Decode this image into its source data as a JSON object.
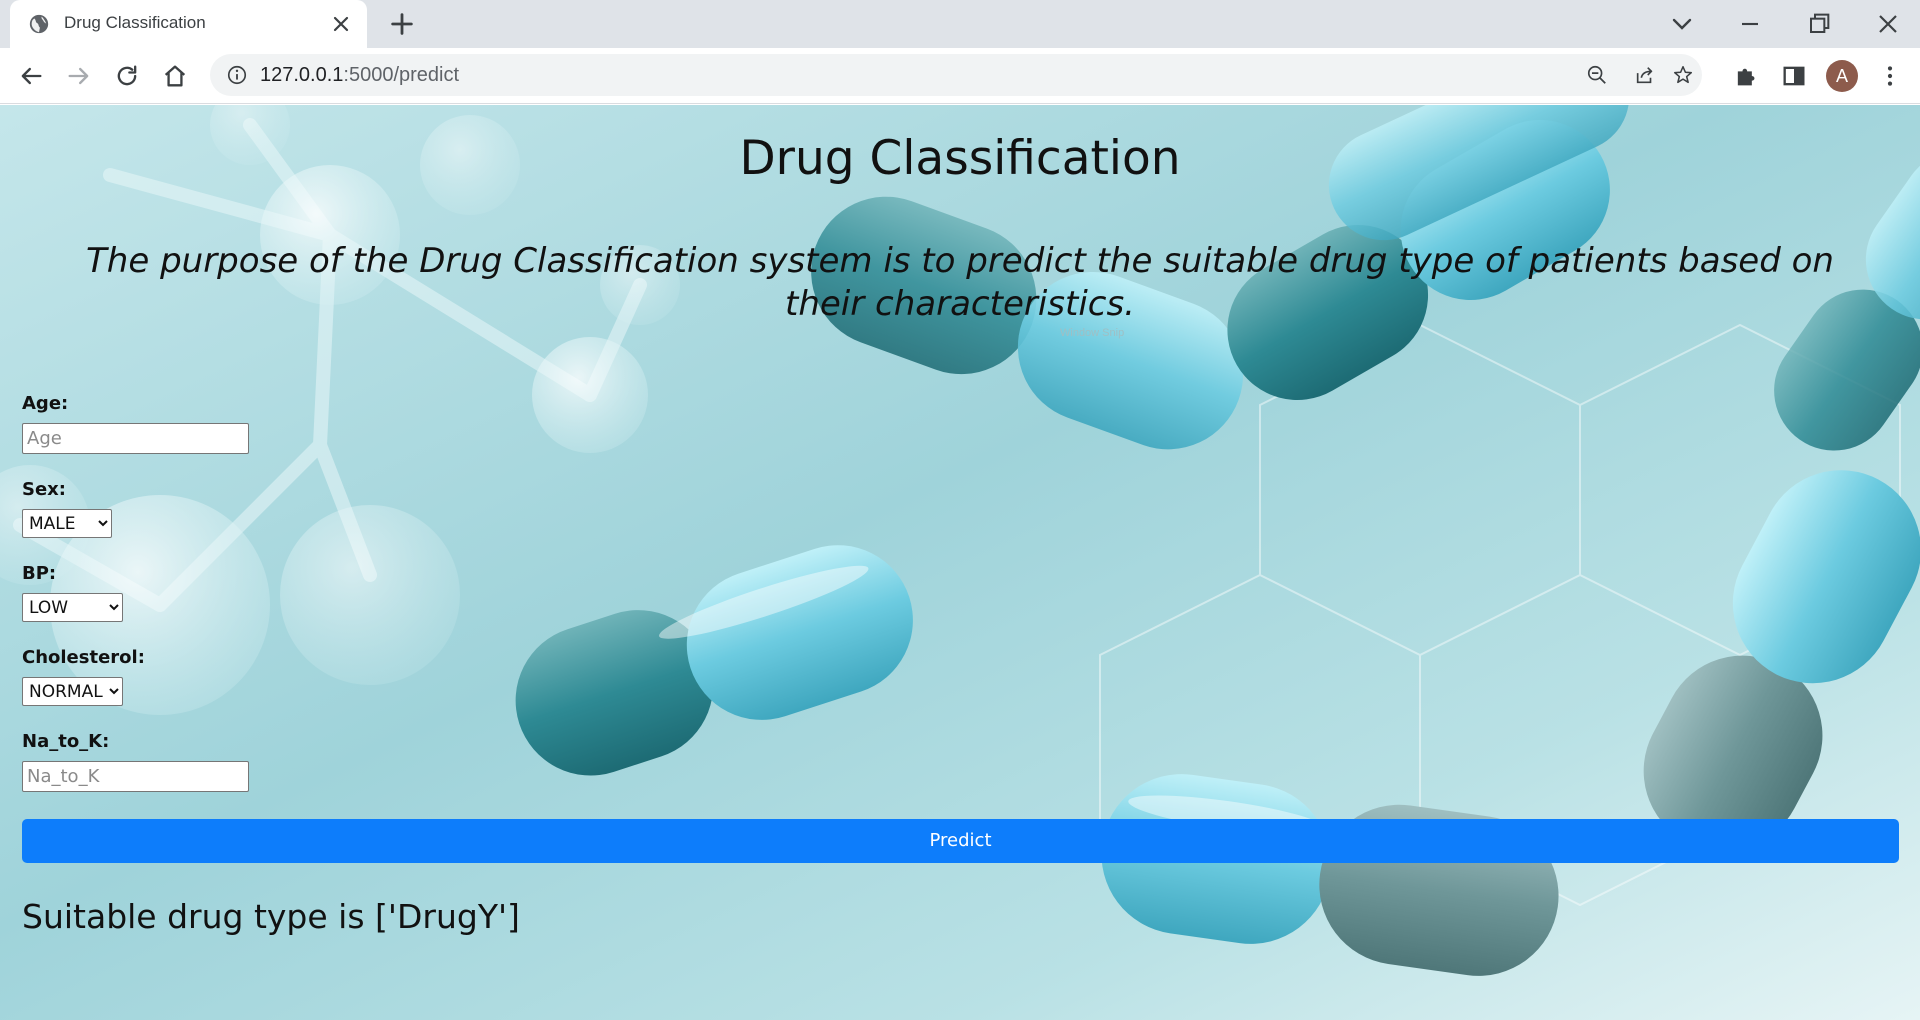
{
  "browser": {
    "tab_title": "Drug Classification",
    "url_host": "127.0.0.1",
    "url_path": ":5000/predict",
    "profile_initial": "A"
  },
  "page": {
    "title": "Drug Classification",
    "description": "The purpose of the Drug Classification system is to predict the suitable drug type of patients based on their characteristics.",
    "watermark": "Window Snip"
  },
  "form": {
    "age": {
      "label": "Age:",
      "placeholder": "Age",
      "value": ""
    },
    "sex": {
      "label": "Sex:",
      "selected": "MALE"
    },
    "bp": {
      "label": "BP:",
      "selected": "LOW"
    },
    "cholesterol": {
      "label": "Cholesterol:",
      "selected": "NORMAL"
    },
    "na_to_k": {
      "label": "Na_to_K:",
      "placeholder": "Na_to_K",
      "value": ""
    },
    "submit_label": "Predict"
  },
  "result": {
    "text": "Suitable drug type is ['DrugY']"
  },
  "colors": {
    "predict_button": "#0d7dfb",
    "page_background": "#a9d9e0",
    "capsule_teal": "#2e8f9c",
    "capsule_light": "#7fd0e2"
  },
  "icons": {
    "back": "arrow-left-icon",
    "forward": "arrow-right-icon",
    "reload": "reload-icon",
    "home": "home-icon",
    "site_info": "info-icon",
    "zoom": "zoom-out-icon",
    "share": "share-icon",
    "bookmark": "star-icon",
    "extensions": "puzzle-icon",
    "side_panel": "side-panel-icon",
    "menu": "kebab-menu-icon"
  }
}
